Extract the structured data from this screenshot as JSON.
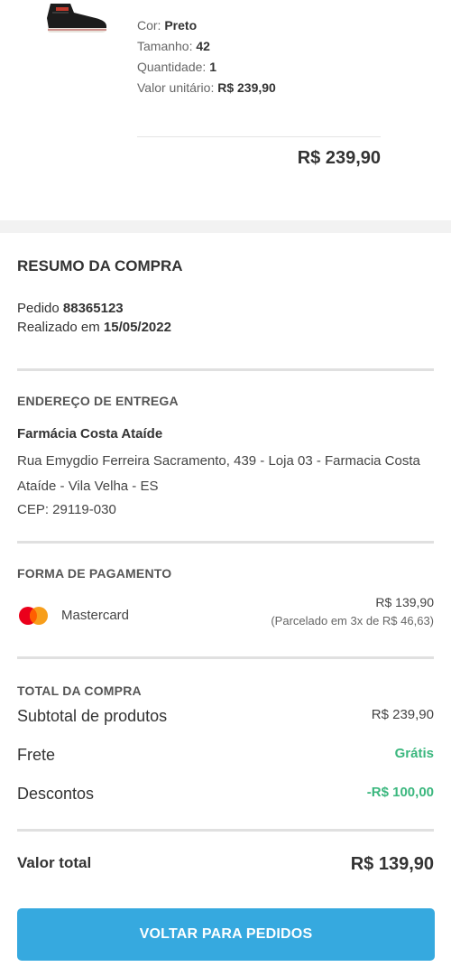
{
  "product": {
    "image_icon": "sneaker-black-image",
    "attributes": [
      {
        "label": "Cor:",
        "value": "Preto"
      },
      {
        "label": "Tamanho:",
        "value": "42"
      },
      {
        "label": "Quantidade:",
        "value": "1"
      },
      {
        "label": "Valor unitário:",
        "value": "R$ 239,90"
      }
    ],
    "total": "R$ 239,90"
  },
  "summary": {
    "title": "RESUMO DA COMPRA",
    "order_prefix": "Pedido",
    "order_number": "88365123",
    "placed_prefix": "Realizado em",
    "placed_date": "15/05/2022"
  },
  "address": {
    "title": "ENDEREÇO DE ENTREGA",
    "name": "Farmácia Costa Ataíde",
    "line": "Rua Emygdio Ferreira Sacramento, 439 - Loja 03 - Farmacia Costa Ataíde - Vila Velha - ES",
    "cep": "CEP: 29119-030"
  },
  "payment": {
    "title": "FORMA DE PAGAMENTO",
    "method_icon": "mastercard-icon",
    "method": "Mastercard",
    "amount": "R$ 139,90",
    "installments": "(Parcelado em 3x de R$ 46,63)"
  },
  "totals": {
    "title": "TOTAL DA COMPRA",
    "rows": [
      {
        "label": "Subtotal de produtos",
        "value": "R$ 239,90"
      },
      {
        "label": "Frete",
        "value": "Grátis"
      },
      {
        "label": "Descontos",
        "value": "-R$ 100,00"
      }
    ],
    "final_label": "Valor total",
    "final_value": "R$ 139,90"
  },
  "actions": {
    "back_label": "VOLTAR PARA PEDIDOS"
  },
  "colors": {
    "accent": "#36a9df",
    "positive": "#3bb77e",
    "section_gap": "#f2f2f2"
  }
}
